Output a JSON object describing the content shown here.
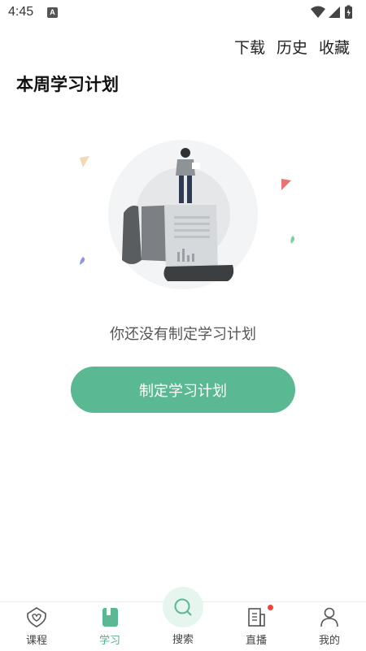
{
  "status_bar": {
    "time": "4:45",
    "notification_glyph": "A"
  },
  "header": {
    "links": [
      "下载",
      "历史",
      "收藏"
    ],
    "title": "本周学习计划"
  },
  "empty_state": {
    "illustration": "person-on-scroll-illustration",
    "message": "你还没有制定学习计划",
    "button_label": "制定学习计划"
  },
  "bottom_nav": {
    "items": [
      {
        "label": "课程",
        "icon": "heart-shield-icon",
        "active": false
      },
      {
        "label": "学习",
        "icon": "book-icon",
        "active": true
      },
      {
        "label": "搜索",
        "icon": "search-icon",
        "active": false
      },
      {
        "label": "直播",
        "icon": "building-icon",
        "active": false,
        "badge": true
      },
      {
        "label": "我的",
        "icon": "person-icon",
        "active": false
      }
    ]
  },
  "colors": {
    "accent": "#5ab892",
    "badge": "#f04438"
  }
}
